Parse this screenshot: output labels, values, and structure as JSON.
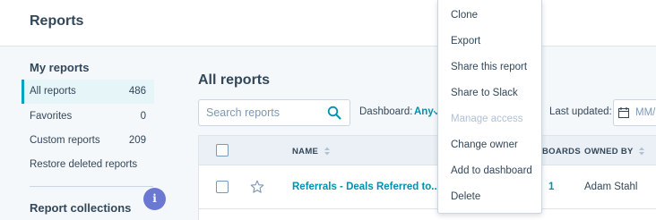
{
  "page": {
    "title": "Reports"
  },
  "sidebar": {
    "my_reports_heading": "My reports",
    "items": [
      {
        "label": "All reports",
        "count": "486"
      },
      {
        "label": "Favorites",
        "count": "0"
      },
      {
        "label": "Custom reports",
        "count": "209"
      },
      {
        "label": "Restore deleted reports",
        "count": ""
      }
    ],
    "collections_heading": "Report collections",
    "info_badge": "i"
  },
  "main": {
    "title": "All reports",
    "search": {
      "placeholder": "Search reports",
      "value": ""
    },
    "filters": {
      "dashboard_label": "Dashboard:",
      "dashboard_value": "Any",
      "last_updated_label": "Last updated:",
      "date_placeholder": "MM/"
    },
    "table": {
      "columns": {
        "name": "NAME",
        "dashboards": "BOARDS",
        "owned_by": "OWNED BY"
      },
      "rows": [
        {
          "name": "Referrals - Deals Referred to...",
          "dashboards": "1",
          "owner": "Adam Stahl"
        }
      ]
    }
  },
  "menu": {
    "items": [
      {
        "label": "Clone",
        "disabled": false
      },
      {
        "label": "Export",
        "disabled": false
      },
      {
        "label": "Share this report",
        "disabled": false
      },
      {
        "label": "Share to Slack",
        "disabled": false
      },
      {
        "label": "Manage access",
        "disabled": true
      },
      {
        "label": "Change owner",
        "disabled": false
      },
      {
        "label": "Add to dashboard",
        "disabled": false
      },
      {
        "label": "Delete",
        "disabled": false
      }
    ]
  },
  "icons": {
    "search": "search-icon",
    "calendar": "calendar-icon",
    "sort": "sort-icon",
    "star": "star-icon",
    "dropdown": "caret-down-icon"
  },
  "colors": {
    "accent": "#00a4bd",
    "link": "#0091ae",
    "badge": "#6a78d1",
    "text": "#33475b"
  }
}
